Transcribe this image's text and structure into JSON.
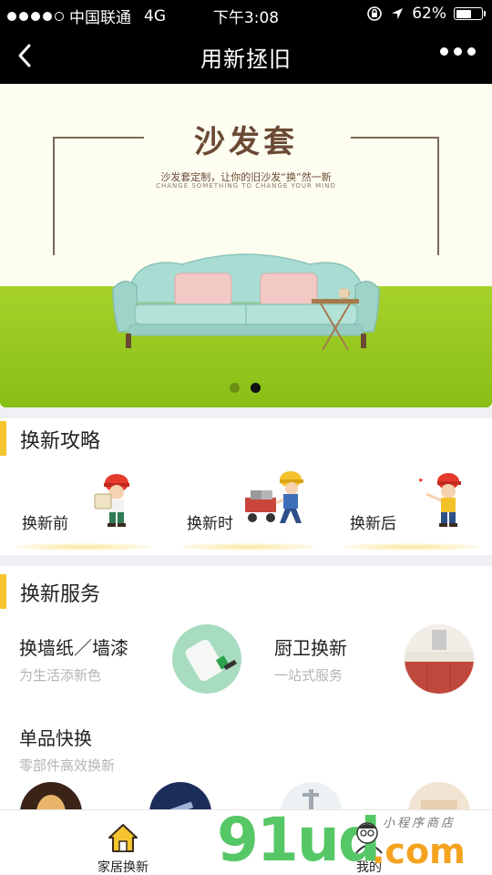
{
  "status_bar": {
    "carrier": "中国联通",
    "network": "4G",
    "time": "下午3:08",
    "battery": "62%",
    "battery_level": 0.62
  },
  "nav": {
    "title": "用新拯旧",
    "back_icon": "chevron-left-icon",
    "more_icon": "more-dots-icon"
  },
  "banner": {
    "heading": "沙发套",
    "subtitle": "沙发套定制，让你的旧沙发“换”然一新",
    "subtitle_en": "CHANGE SOMETHING TO CHANGE YOUR MIND",
    "active_index": 1,
    "slide_count": 2,
    "colors": {
      "active": "#111111",
      "inactive": "#6a8f12"
    }
  },
  "guide": {
    "title": "换新攻略",
    "items": [
      {
        "label": "换新前",
        "icon": "worker-reading-icon"
      },
      {
        "label": "换新时",
        "icon": "worker-pushing-cart-icon"
      },
      {
        "label": "换新后",
        "icon": "worker-waving-icon"
      }
    ]
  },
  "services": {
    "title": "换新服务",
    "items": [
      {
        "name": "换墙纸／墙漆",
        "desc": "为生活添新色"
      },
      {
        "name": "厨卫换新",
        "desc": "一站式服务"
      },
      {
        "name": "单品快换",
        "desc": "零部件高效换新"
      }
    ]
  },
  "tab_bar": {
    "items": [
      {
        "label": "家居换新",
        "icon": "home-icon"
      },
      {
        "label": "我的",
        "icon": "profile-icon"
      }
    ]
  },
  "watermark": {
    "brand": "91ud",
    "domain": ".com",
    "tagline": "小程序商店"
  },
  "accent_color": "#f5c530"
}
